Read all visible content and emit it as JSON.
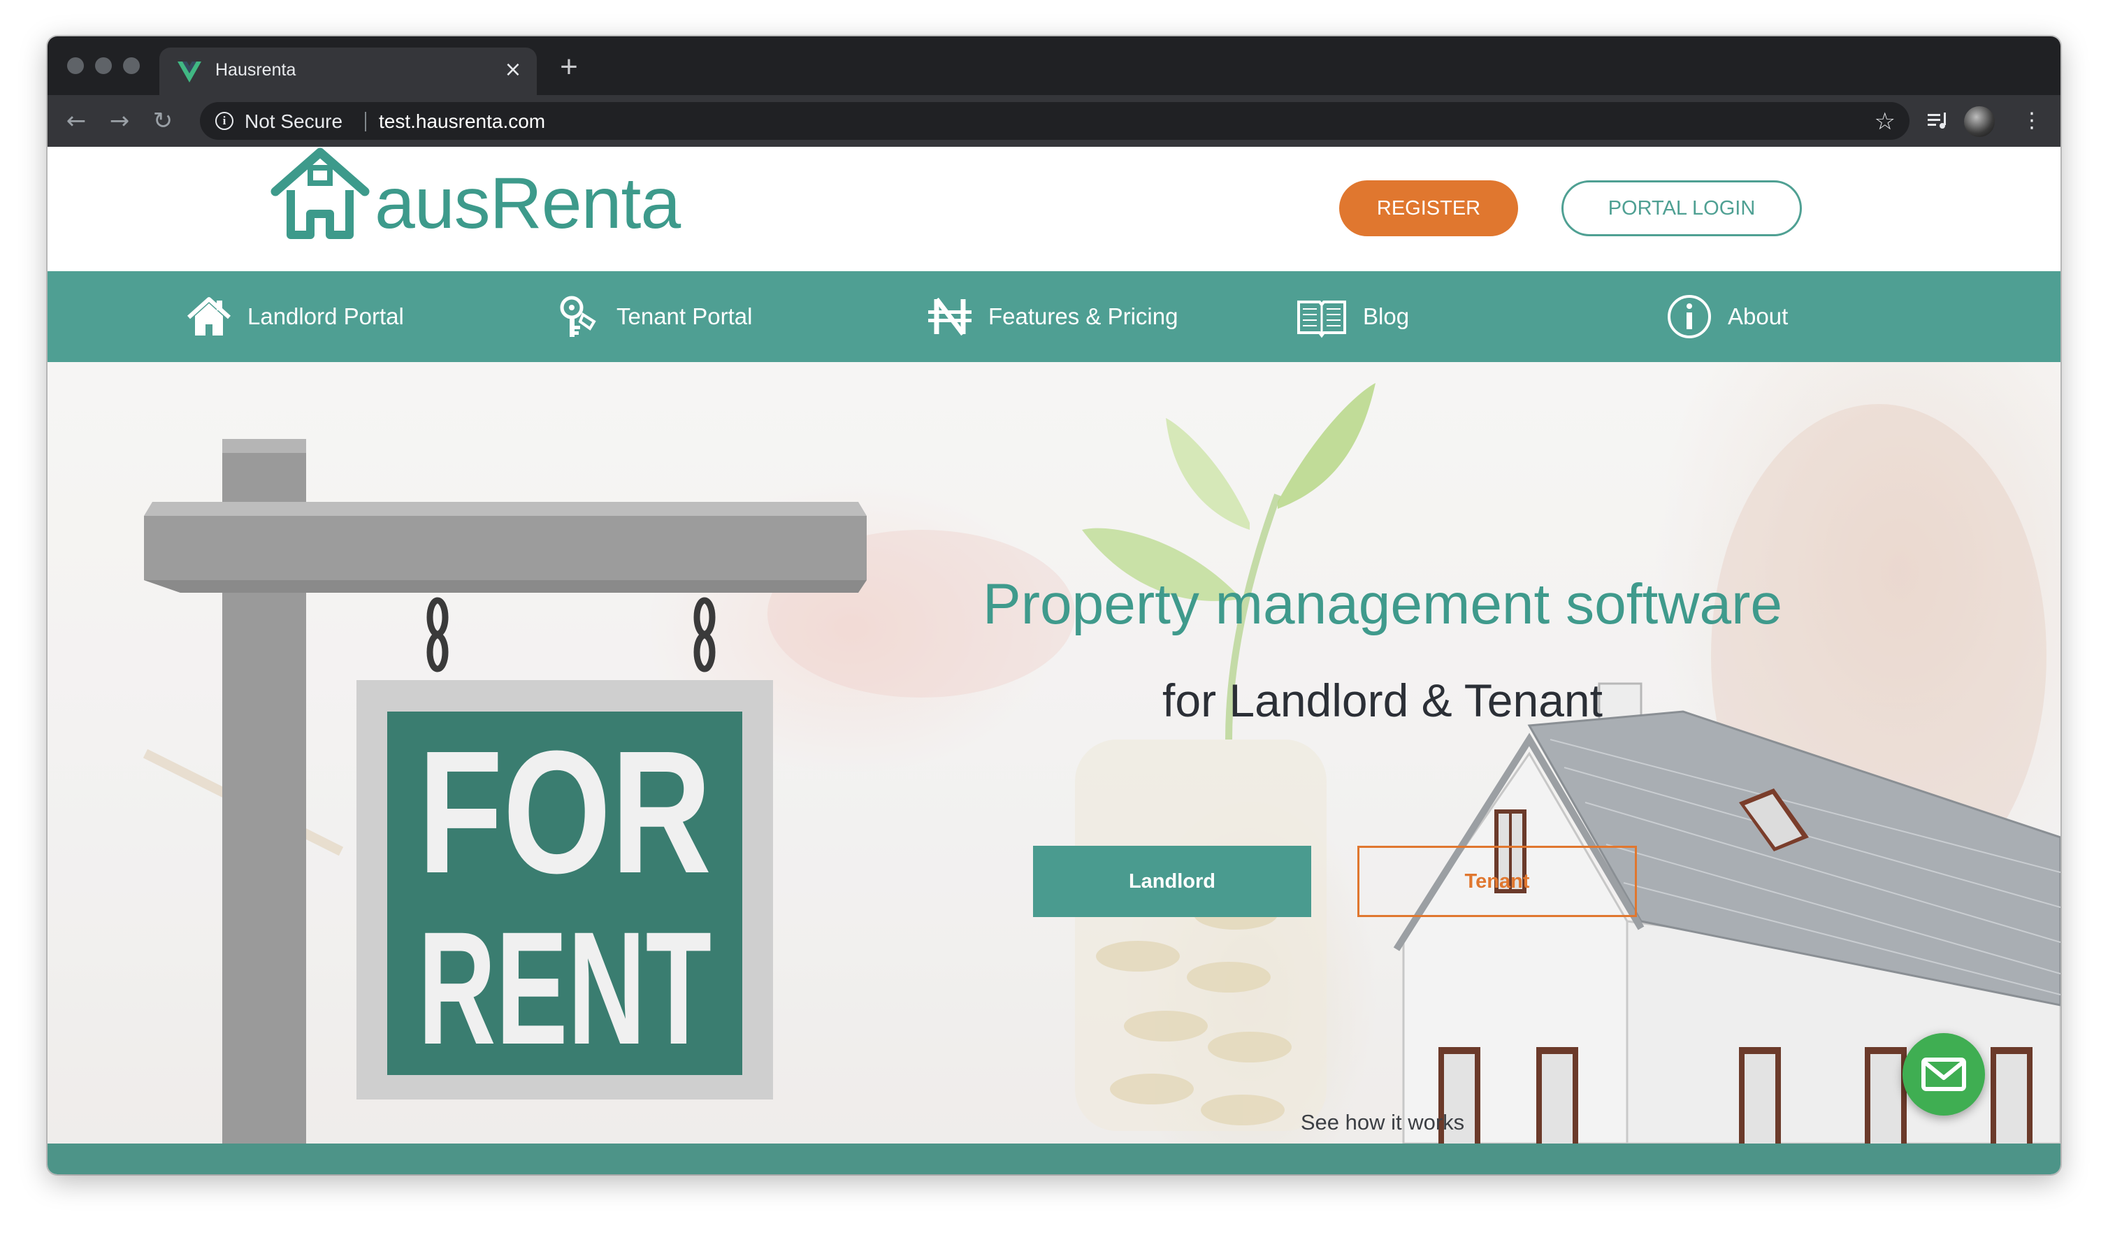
{
  "browser": {
    "tab_title": "Hausrenta",
    "close_glyph": "×",
    "new_tab_glyph": "+",
    "security_label": "Not Secure",
    "url": "test.hausrenta.com"
  },
  "header": {
    "logo_text": "ausRenta",
    "register_label": "REGISTER",
    "login_label": "PORTAL LOGIN"
  },
  "nav": {
    "items": [
      {
        "label": "Landlord Portal",
        "icon": "house-icon"
      },
      {
        "label": "Tenant Portal",
        "icon": "keys-icon"
      },
      {
        "label": "Features & Pricing",
        "icon": "naira-icon"
      },
      {
        "label": "Blog",
        "icon": "book-icon"
      },
      {
        "label": "About",
        "icon": "info-icon"
      }
    ]
  },
  "hero": {
    "headline": "Property management software",
    "subheadline": "for Landlord & Tenant",
    "landlord_button": "Landlord",
    "tenant_button": "Tenant",
    "see_how": "See how it works",
    "sign_line1": "FOR",
    "sign_line2": "RENT"
  },
  "colors": {
    "brand_teal": "#4f9f93",
    "accent_orange": "#e0772f",
    "chat_green": "#3fae52"
  }
}
